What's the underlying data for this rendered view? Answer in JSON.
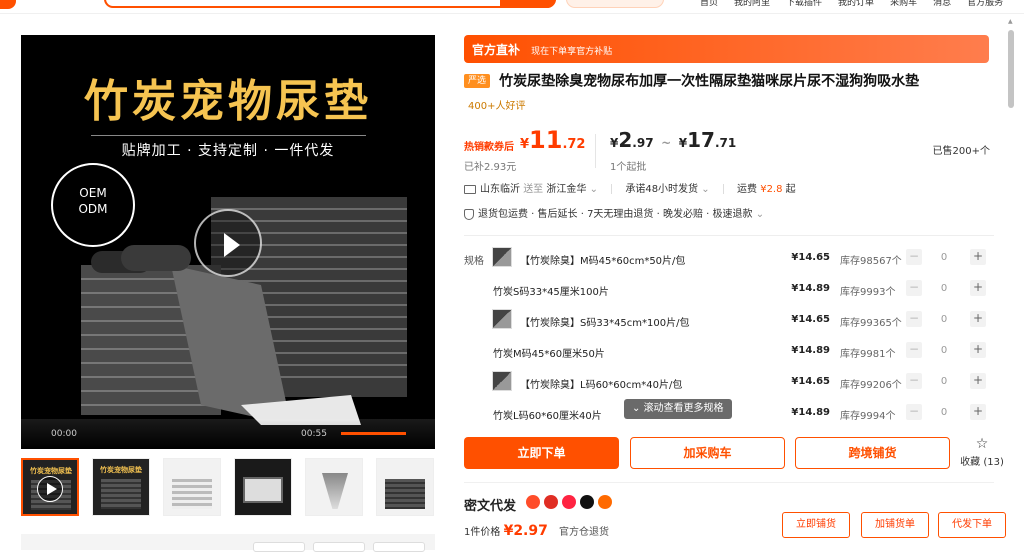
{
  "topnav": {
    "items": [
      "首页",
      "我的阿里",
      "下载插件",
      "我的订单",
      "采购车",
      "消息",
      "官方服务"
    ]
  },
  "gallery": {
    "main_title": "竹炭宠物尿垫",
    "main_subtitle": "贴牌加工 · 支持定制 · 一件代发",
    "badge_line1": "OEM",
    "badge_line2": "ODM",
    "video_time_left": "00:00",
    "video_time_right": "00:55",
    "thumb_titles": [
      "竹炭宠物尿垫",
      "竹炭宠物尿垫",
      "",
      "",
      "",
      ""
    ]
  },
  "product": {
    "official_banner": "官方直补",
    "official_sub": "现在下单享官方补贴",
    "yanxuan_badge": "严选",
    "title": "竹炭尿垫除臭宠物尿布加厚一次性隔尿垫猫咪尿片尿不湿狗狗吸水垫",
    "reviews": "400+人好评"
  },
  "price": {
    "label": "热销款券后",
    "currency": "¥",
    "main_int": "11",
    "main_dec": ".72",
    "subsidy": "已补2.93元",
    "range_low_int": "2",
    "range_low_dec": ".97",
    "range_sep": "~",
    "range_high_int": "17",
    "range_high_dec": ".71",
    "min_order": "1个起批",
    "sold": "已售200+个"
  },
  "shipping": {
    "from": "山东临沂",
    "send_to": "送至",
    "dest": "浙江金华",
    "promise": "承诺48小时发货",
    "freight_label": "运费",
    "freight_value": "¥2.8",
    "freight_suffix": "起"
  },
  "guarantee": {
    "text": "退货包运费 · 售后延长 · 7天无理由退货 · 晚发必赔 · 极速退款"
  },
  "sku": {
    "label": "规格",
    "rows": [
      {
        "name": "【竹炭除臭】M码45*60cm*50片/包",
        "price": "¥14.65",
        "stock": "库存98567个",
        "qty": "0",
        "img": true
      },
      {
        "name": "竹炭S码33*45厘米100片",
        "price": "¥14.89",
        "stock": "库存9993个",
        "qty": "0",
        "img": false
      },
      {
        "name": "【竹炭除臭】S码33*45cm*100片/包",
        "price": "¥14.65",
        "stock": "库存99365个",
        "qty": "0",
        "img": true
      },
      {
        "name": "竹炭M码45*60厘米50片",
        "price": "¥14.89",
        "stock": "库存9981个",
        "qty": "0",
        "img": false
      },
      {
        "name": "【竹炭除臭】L码60*60cm*40片/包",
        "price": "¥14.65",
        "stock": "库存99206个",
        "qty": "0",
        "img": true
      },
      {
        "name": "竹炭L码60*60厘米40片",
        "price": "¥14.89",
        "stock": "库存9994个",
        "qty": "0",
        "img": false
      }
    ],
    "more": "滚动查看更多规格"
  },
  "actions": {
    "buy_now": "立即下单",
    "add_cart": "加采购车",
    "cross_border": "跨境铺货",
    "favorite": "收藏 (13)"
  },
  "miwen": {
    "title": "密文代发",
    "unit_label": "1件价格",
    "unit_currency": "¥",
    "unit_value": "2.97",
    "warehouse": "官方仓退货",
    "btn_list": "立即铺货",
    "btn_add": "加铺货单",
    "btn_order": "代发下单"
  },
  "colors": {
    "brand": "#ff5000",
    "price": "#ff3c00"
  }
}
